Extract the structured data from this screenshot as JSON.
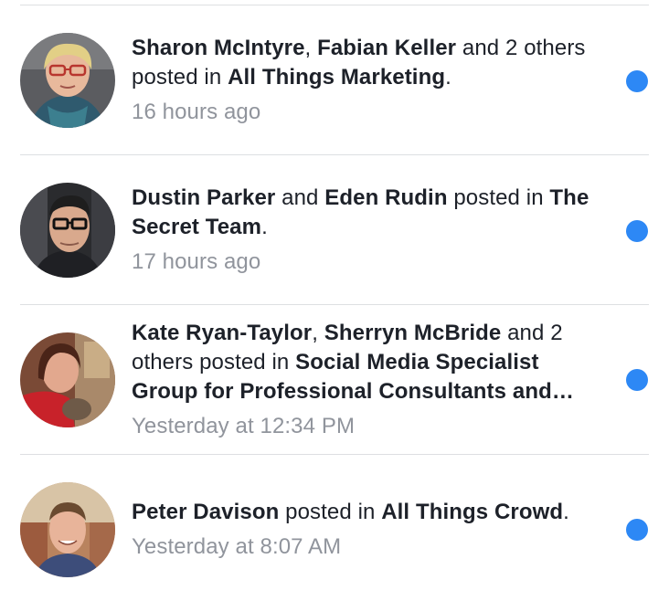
{
  "notifications": [
    {
      "actors": [
        "Sharon McIntyre",
        "Fabian Keller"
      ],
      "sep1": ", ",
      "sep2": " and 2 others posted in ",
      "group": "All Things Marketing",
      "end": ".",
      "time": "16 hours ago",
      "unread": true
    },
    {
      "actors": [
        "Dustin Parker",
        "Eden Rudin"
      ],
      "sep1": " and ",
      "sep2": " posted in ",
      "group": "The Secret Team",
      "end": ".",
      "time": "17 hours ago",
      "unread": true
    },
    {
      "actors": [
        "Kate Ryan-Taylor",
        "Sherryn McBride"
      ],
      "sep1": ", ",
      "sep2": " and 2 others posted in ",
      "group": "Social Media Specialist Group for Professional Consultants and…",
      "end": "",
      "time": "Yesterday at 12:34 PM",
      "unread": true
    },
    {
      "actors": [
        "Peter Davison"
      ],
      "sep1": "",
      "sep2": " posted in ",
      "group": "All Things Crowd",
      "end": ".",
      "time": "Yesterday at 8:07 AM",
      "unread": true
    }
  ],
  "colors": {
    "unread_dot": "#2d88f5",
    "timestamp": "#90949c",
    "divider": "#dddfe2"
  }
}
